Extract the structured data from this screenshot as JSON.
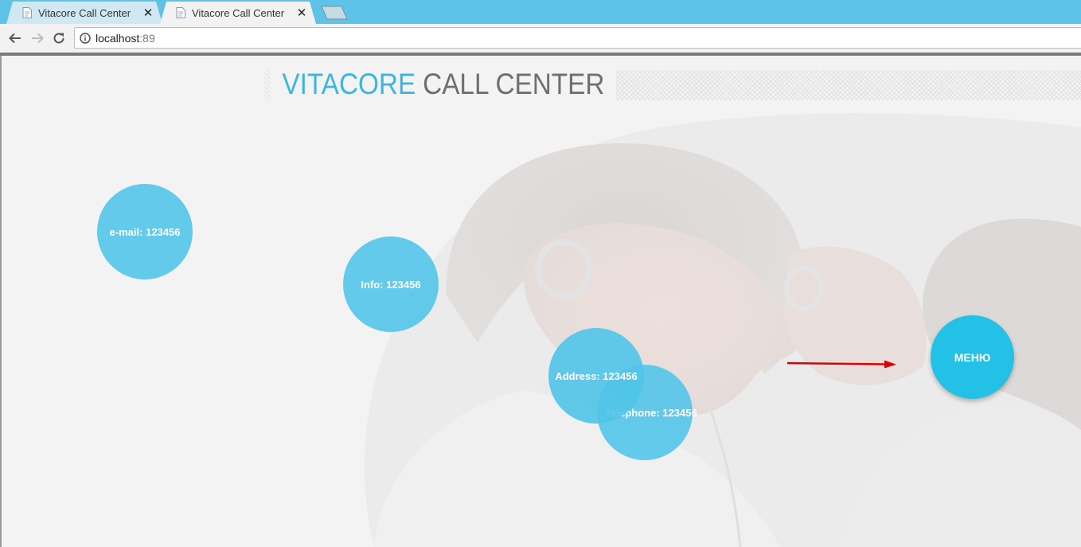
{
  "browser": {
    "tabs": [
      {
        "title": "Vitacore Call Center",
        "active": false
      },
      {
        "title": "Vitacore Call Center",
        "active": true
      }
    ],
    "url_host": "localhost",
    "url_port": ":89"
  },
  "header": {
    "brand_first": "VITACORE",
    "brand_second": "CALL CENTER"
  },
  "bubbles": {
    "email": "e-mail: 123456",
    "info": "Info: 123456",
    "address": "Address: 123456",
    "telephone": "Telephone: 123456",
    "menu": "МЕНЮ"
  },
  "colors": {
    "accent": "#3cb6dd",
    "bubble": "#50c4e9",
    "menu_button": "#24c1e6",
    "arrow": "#e00000",
    "tabstrip": "#5ec3e6"
  },
  "icons": {
    "back": "arrow-left-icon",
    "forward": "arrow-right-icon",
    "reload": "reload-icon",
    "info": "info-icon",
    "close": "close-icon",
    "favicon": "page-icon"
  }
}
